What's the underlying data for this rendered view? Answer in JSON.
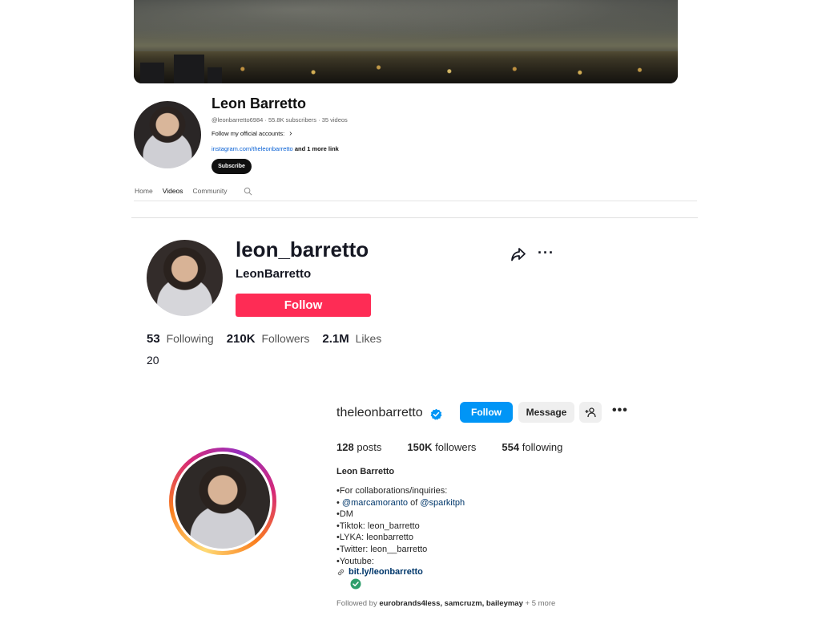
{
  "youtube": {
    "channel_name": "Leon Barretto",
    "handle": "@leonbarretto6984",
    "subscribers": "55.8K subscribers",
    "videos": "35 videos",
    "meta_sep": " · ",
    "follow_text": "Follow my official accounts:",
    "link_text": "instagram.com/theleonbarretto",
    "link_more": "and 1 more link",
    "subscribe_label": "Subscribe",
    "tabs": [
      {
        "label": "Home",
        "active": false
      },
      {
        "label": "Videos",
        "active": true
      },
      {
        "label": "Community",
        "active": false
      }
    ],
    "search_icon": "search-icon"
  },
  "tiktok": {
    "username": "leon_barretto",
    "nickname": "LeonBarretto",
    "follow_label": "Follow",
    "stats": [
      {
        "value": "53",
        "label": "Following"
      },
      {
        "value": "210K",
        "label": "Followers"
      },
      {
        "value": "2.1M",
        "label": "Likes"
      }
    ],
    "bio": "20",
    "accent_color": "#fe2c55"
  },
  "instagram": {
    "username": "theleonbarretto",
    "follow_label": "Follow",
    "message_label": "Message",
    "stats": [
      {
        "value": "128",
        "label": "posts"
      },
      {
        "value": "150K",
        "label": "followers"
      },
      {
        "value": "554",
        "label": "following"
      }
    ],
    "full_name": "Leon Barretto",
    "bio_line1": "•For collaborations/inquiries:",
    "bio_bullet": "• ",
    "mention1": "@marcamoranto",
    "of": " of ",
    "mention2": "@sparkitph",
    "bio_line3": "•DM",
    "bio_line4": "•Tiktok: leon_barretto",
    "bio_line5": "•LYKA: leonbarretto",
    "bio_line6": "•Twitter: leon__barretto",
    "bio_line7": "•Youtube:",
    "link": "bit.ly/leonbarretto",
    "followed_by_prefix": "Followed by ",
    "followed_by_names": "eurobrands4less, samcruzm, baileymay",
    "followed_by_more": " + 5 more",
    "accent_color": "#0095f6"
  }
}
